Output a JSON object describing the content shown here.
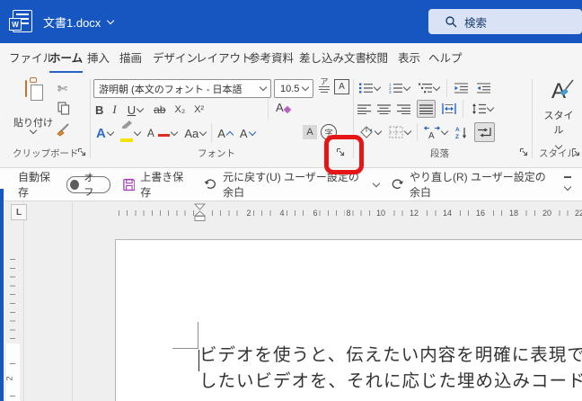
{
  "window": {
    "title": "文書1.docx"
  },
  "search": {
    "label": "検索"
  },
  "tabs": [
    {
      "label": "ファイル",
      "active": false
    },
    {
      "label": "ホーム",
      "active": true
    },
    {
      "label": "挿入",
      "active": false
    },
    {
      "label": "描画",
      "active": false
    },
    {
      "label": "デザイン",
      "active": false
    },
    {
      "label": "レイアウト",
      "active": false
    },
    {
      "label": "参考資料",
      "active": false
    },
    {
      "label": "差し込み文書",
      "active": false
    },
    {
      "label": "校閲",
      "active": false
    },
    {
      "label": "表示",
      "active": false
    },
    {
      "label": "ヘルプ",
      "active": false
    }
  ],
  "ribbon": {
    "clipboard": {
      "paste": "貼り付け",
      "label": "クリップボード"
    },
    "font": {
      "name": "游明朝 (本文のフォント - 日本語",
      "size": "10.5",
      "label": "フォント",
      "bold": "B",
      "italic": "I",
      "underline": "U",
      "strike": "ab",
      "subscript": "X₂",
      "superscript": "X²",
      "clear": "A",
      "effects": "A",
      "color": "A",
      "case": "Aa",
      "grow": "A",
      "shrink": "A",
      "shade": "A",
      "char_border": "A",
      "ruby": "ア",
      "enclose": "字"
    },
    "paragraph": {
      "label": "段落"
    },
    "styles": {
      "button": "スタイル",
      "label": "スタイル",
      "big_a": "A"
    }
  },
  "qat": {
    "autosave": "自動保存",
    "autosave_state": "オフ",
    "save": "上書き保存",
    "undo": "元に戻す(U) ユーザー設定の余白",
    "redo": "やり直し(R) ユーザー設定の余白"
  },
  "ruler": {
    "h_numbers": [
      "2",
      "4",
      "6",
      "8",
      "10",
      "12",
      "14",
      "16",
      "18",
      "20",
      "22"
    ],
    "v_number": "2",
    "tab_selector": "L"
  },
  "document": {
    "line1": "ビデオを使うと、伝えたい内容を明確に表現できます",
    "line2": "したいビデオを、それに応じた埋め込みコードの形式"
  },
  "icons": {
    "logo_letter": "W",
    "numbering_1": "1",
    "numbering_2": "2",
    "numbering_3": "3",
    "sort_a": "A",
    "sort_z": "Z"
  },
  "annotation": {
    "type": "highlight-box",
    "target": "font-dialog-launcher",
    "color": "#e41616"
  },
  "colors": {
    "titlebar_blue": "#1656c1",
    "accent_blue": "#2464c9",
    "highlight_red": "#e41616",
    "save_purple": "#a23fb8",
    "font_color_red": "#e02b20",
    "highlighter_yellow": "#f3e400"
  }
}
